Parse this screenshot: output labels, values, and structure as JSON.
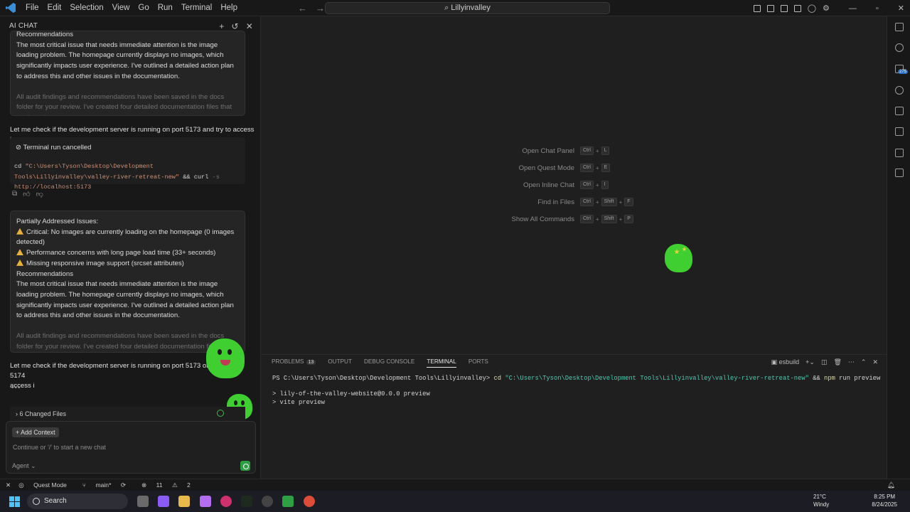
{
  "menu": [
    "File",
    "Edit",
    "Selection",
    "View",
    "Go",
    "Run",
    "Terminal",
    "Help"
  ],
  "search": {
    "text": "Lillyinvalley"
  },
  "chat": {
    "header": "AI CHAT",
    "card1": {
      "heading": "Recommendations",
      "body": "The most critical issue that needs immediate attention is the image loading problem. The homepage currently displays no images, which significantly impacts user experience. I've outlined a detailed action plan to address this and other issues in the documentation.",
      "faded": "All audit findings and recommendations have been saved in the docs folder for your review. I've created four detailed documentation files that analyze the current"
    },
    "msg1": "Let me check if the development server is running on port 5173 and try to access it:",
    "terminal_status": "Terminal run cancelled",
    "cmd_prefix": "cd",
    "cmd_path": "\"C:\\Users\\Tyson\\Desktop\\Development Tools\\Lillyinvalley\\valley-river-retreat-new\"",
    "cmd_rest": "&& curl",
    "cmd_flag": "-s",
    "cmd_url": "http://localhost:5173",
    "card2": {
      "heading": "Partially Addressed Issues:",
      "issues": [
        "Critical: No images are currently loading on the homepage (0 images detected)",
        "Performance concerns with long page load time (33+ seconds)",
        "Missing responsive image support (srcset attributes)"
      ],
      "rec_heading": "Recommendations",
      "body": "The most critical issue that needs immediate attention is the image loading problem. The homepage currently displays no images, which significantly impacts user experience. I've outlined a detailed action plan to address this and other issues in the documentation.",
      "faded": "All audit findings and recommendations have been saved in the docs folder for your review. I've created four detailed documentation files that analyze"
    },
    "msg2_a": "Let me check if the development server is running on port 5173 or 5174",
    "msg2_b": "access i",
    "changed_files": "6 Changed Files",
    "add_context": "Add Context",
    "placeholder": "Continue or '/' to start a new chat",
    "agent": "Agent"
  },
  "shortcuts": [
    {
      "label": "Open Chat Panel",
      "keys": [
        "Ctrl",
        "L"
      ]
    },
    {
      "label": "Open Quest Mode",
      "keys": [
        "Ctrl",
        "E"
      ]
    },
    {
      "label": "Open Inline Chat",
      "keys": [
        "Ctrl",
        "I"
      ]
    },
    {
      "label": "Find in Files",
      "keys": [
        "Ctrl",
        "Shift",
        "F"
      ]
    },
    {
      "label": "Show All Commands",
      "keys": [
        "Ctrl",
        "Shift",
        "P"
      ]
    }
  ],
  "panel": {
    "tabs": [
      "PROBLEMS",
      "OUTPUT",
      "DEBUG CONSOLE",
      "TERMINAL",
      "PORTS"
    ],
    "problems_count": "13",
    "active_tab": "TERMINAL",
    "shell": "esbuild",
    "prompt": "PS C:\\Users\\Tyson\\Desktop\\Development Tools\\Lillyinvalley>",
    "cmd_cd": "cd",
    "cmd_path": "\"C:\\Users\\Tyson\\Desktop\\Development Tools\\Lillyinvalley\\valley-river-retreat-new\"",
    "cmd_and": "&&",
    "cmd_npm": "npm",
    "cmd_rest": "run preview",
    "out1": "> lily-of-the-valley-website@0.0.0 preview",
    "out2": "> vite preview"
  },
  "activity_badge": "275",
  "status": {
    "mode": "Quest Mode",
    "branch": "main*",
    "errors": "11",
    "warnings": "2"
  },
  "taskbar": {
    "search": "Search",
    "temp": "21°C",
    "weather": "Windy",
    "time": "8:25 PM",
    "date": "8/24/2025"
  },
  "colors": {
    "accent": "#2ea043",
    "blob": "#3fcf31",
    "warning": "#e8b13a"
  }
}
